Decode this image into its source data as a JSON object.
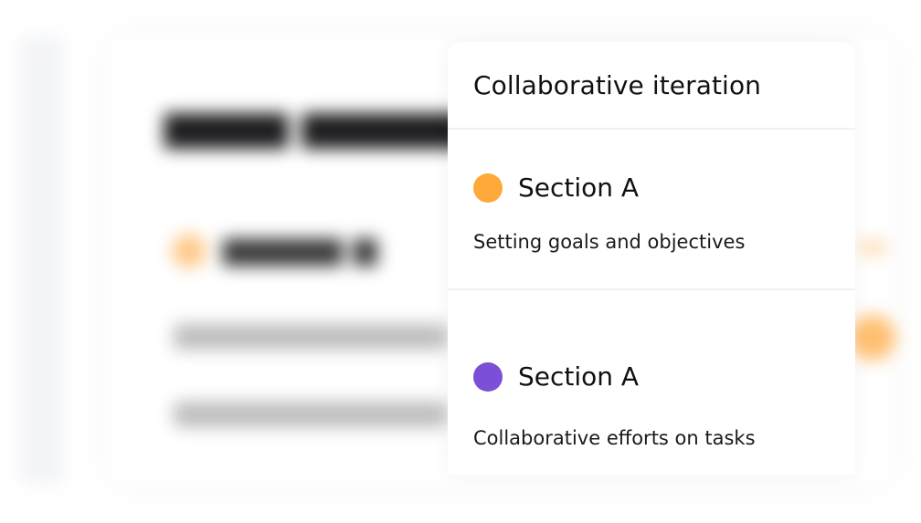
{
  "card": {
    "title": "Collaborative iteration",
    "sections": [
      {
        "name": "Section A",
        "description": "Setting goals and objectives",
        "dot_color": "#FFA93A"
      },
      {
        "name": "Section A",
        "description": "Collaborative efforts on tasks",
        "dot_color": "#7B4FD6"
      }
    ]
  },
  "colors": {
    "background": "#FFFFFF",
    "card_background": "#FFFFFF",
    "divider": "#F1F1F3",
    "text": "#111111"
  }
}
